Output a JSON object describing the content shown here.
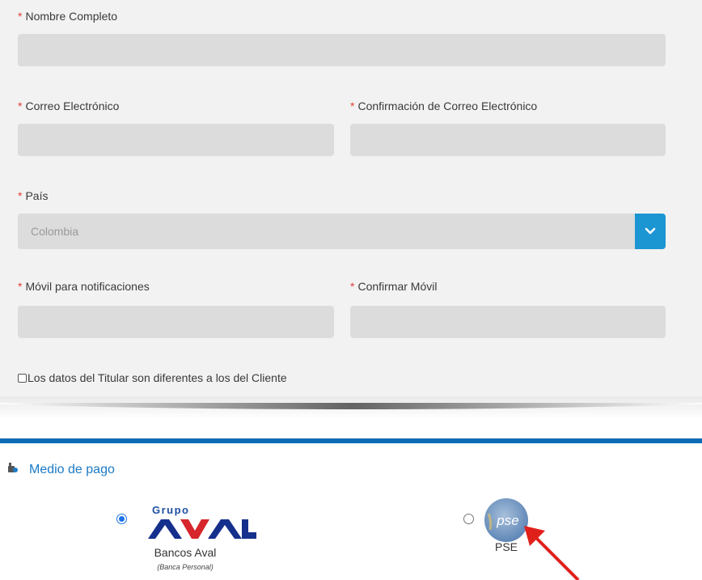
{
  "form": {
    "full_name": {
      "required_mark": "*",
      "label": "Nombre Completo",
      "value": ""
    },
    "email": {
      "required_mark": "*",
      "label": "Correo Electrónico",
      "value": ""
    },
    "email_confirm": {
      "required_mark": "*",
      "label": "Confirmación de Correo Electrónico",
      "value": ""
    },
    "country": {
      "required_mark": "*",
      "label": "País",
      "selected": "Colombia",
      "icon": "chevron-down-icon"
    },
    "mobile": {
      "required_mark": "*",
      "label": "Móvil para notificaciones",
      "value": ""
    },
    "mobile_confirm": {
      "required_mark": "*",
      "label": "Confirmar Móvil",
      "value": ""
    },
    "holder_checkbox": {
      "label": "Los datos del Titular son diferentes a los del Cliente",
      "checked": false
    }
  },
  "payment": {
    "title": "Medio de pago",
    "title_icon": "payment-icon",
    "options": [
      {
        "logo_text_top": "Grupo",
        "logo_text_main": "AVAL",
        "label": "Bancos Aval",
        "sublabel": "(Banca Personal)",
        "selected": true
      },
      {
        "logo_text": "pse",
        "label": "PSE",
        "selected": false
      }
    ]
  },
  "annotation": {
    "icon": "red-arrow-icon",
    "color": "#e0201b"
  },
  "colors": {
    "required": "#e0413a",
    "accent_blue": "#1c95d3",
    "section_blue": "#0b6cb4",
    "field_bg": "#dcdcdc",
    "panel_bg": "#f2f2f2"
  }
}
